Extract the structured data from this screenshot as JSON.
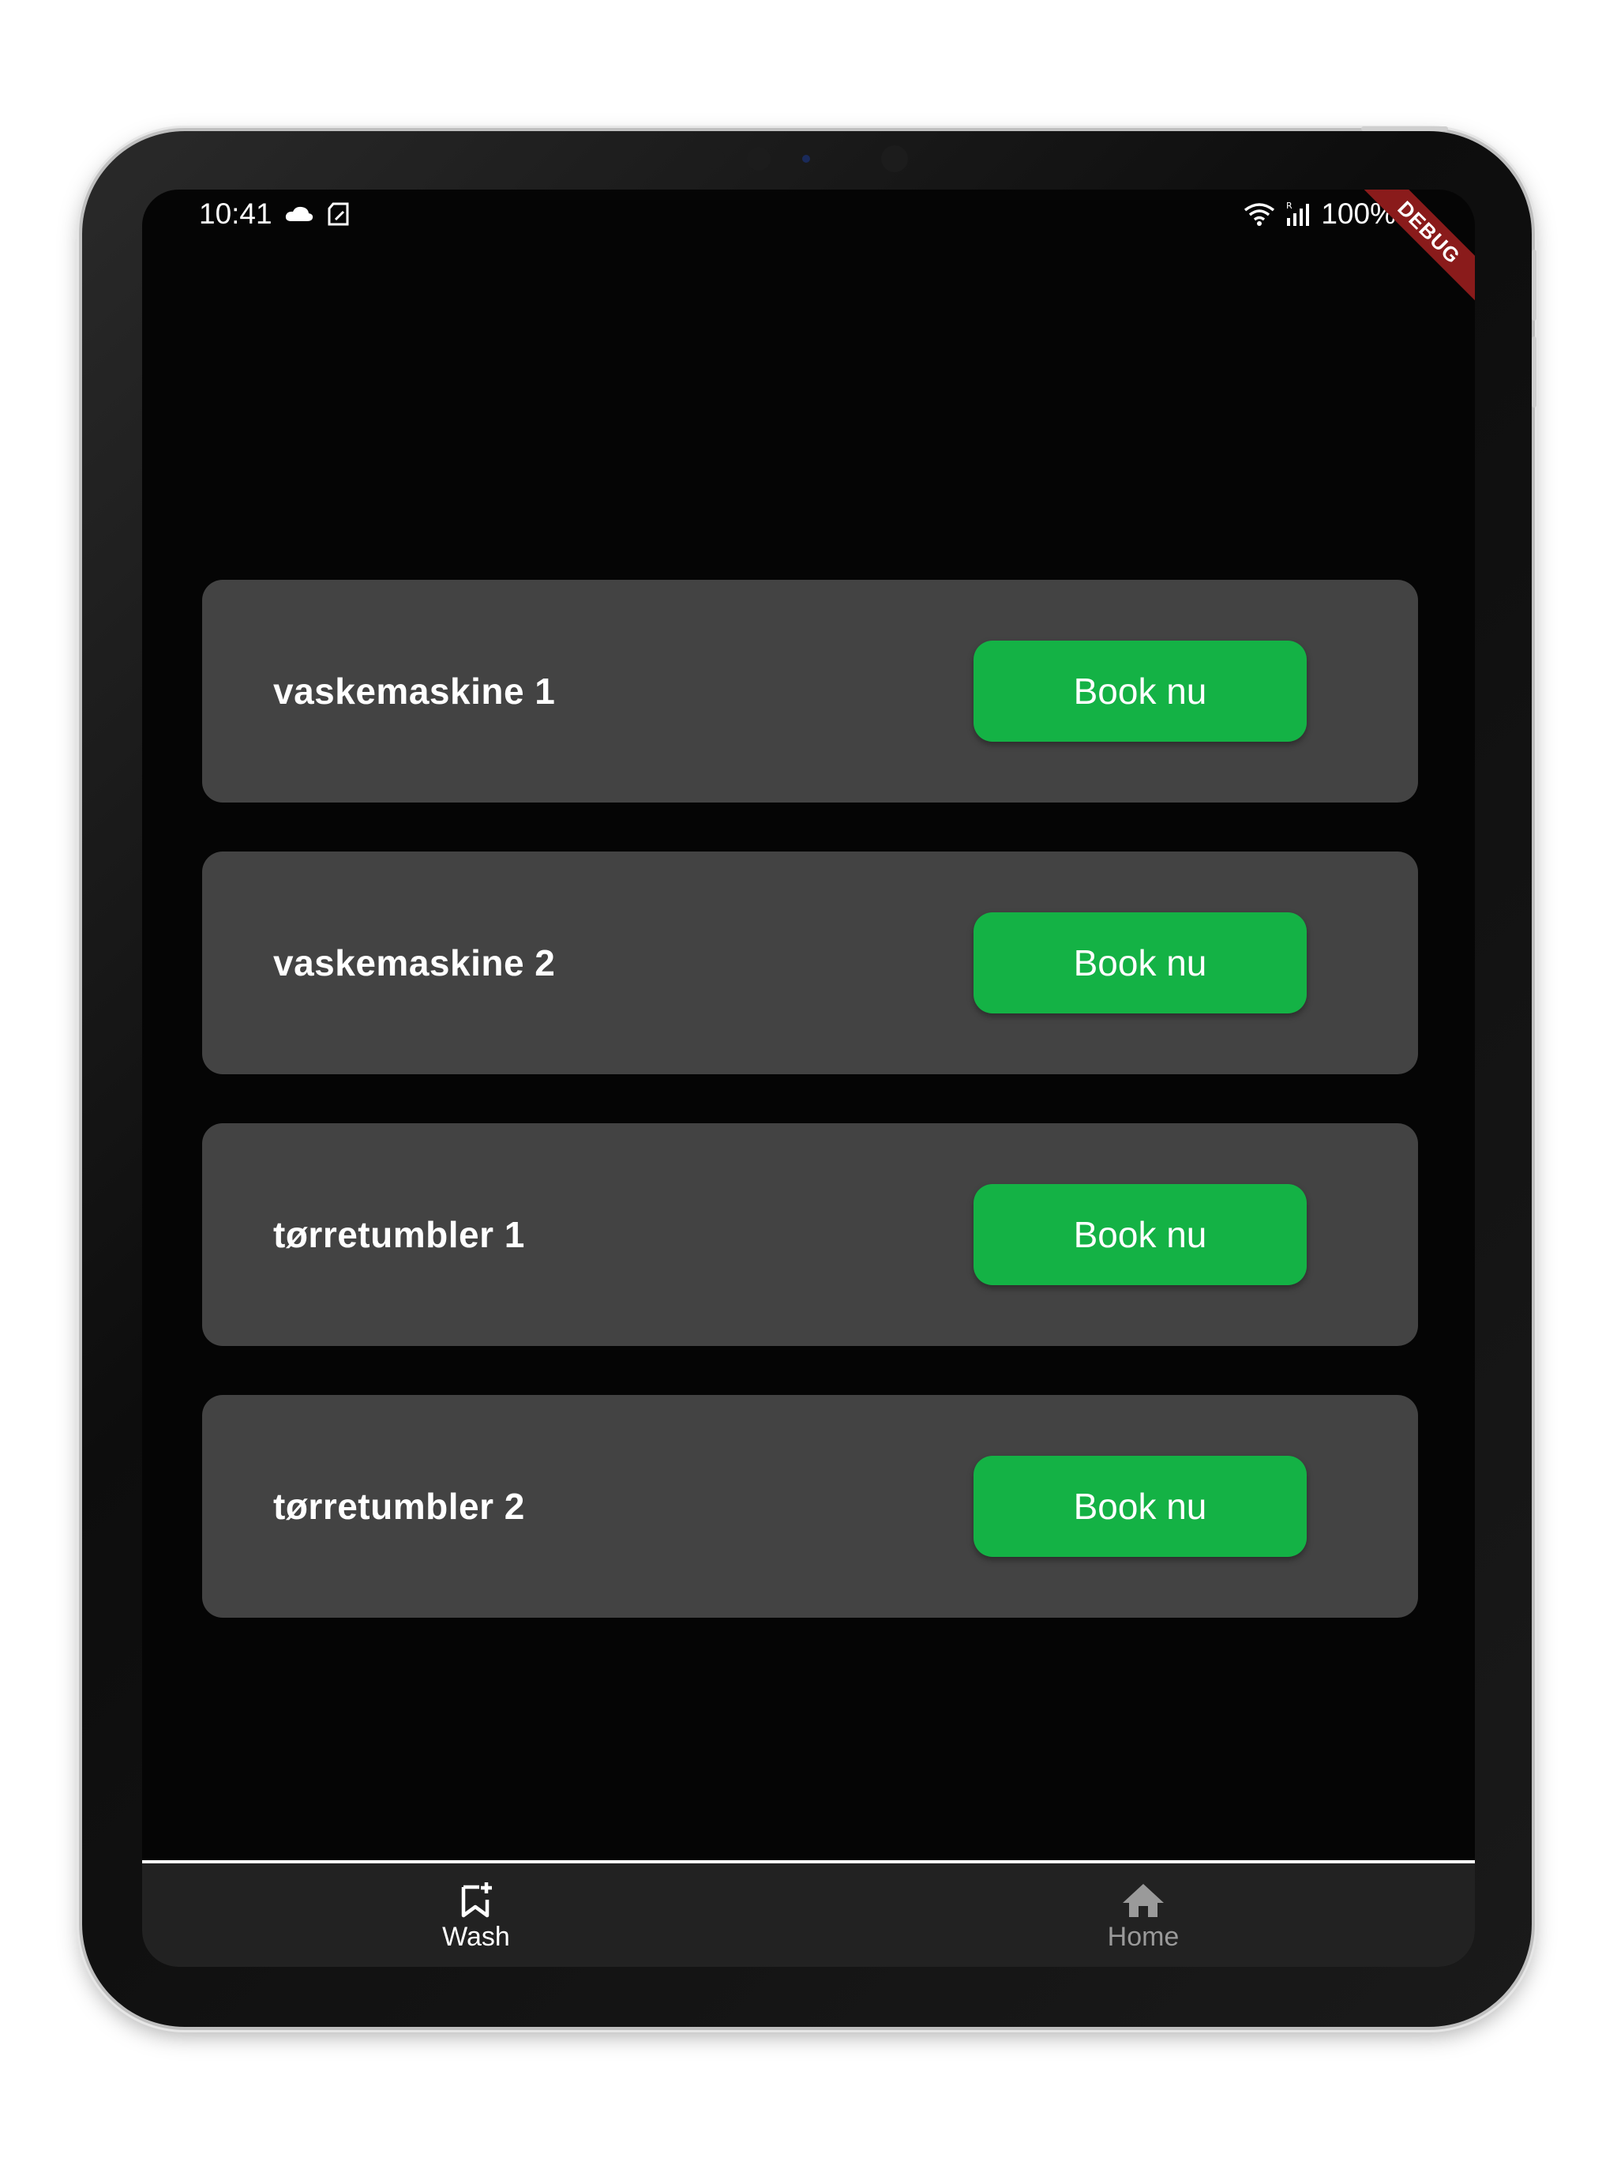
{
  "status_bar": {
    "time": "10:41",
    "battery_text": "100%"
  },
  "debug_banner": "DEBUG",
  "machines": [
    {
      "name": "vaskemaskine 1",
      "button_label": "Book nu"
    },
    {
      "name": "vaskemaskine 2",
      "button_label": "Book nu"
    },
    {
      "name": "tørretumbler 1",
      "button_label": "Book nu"
    },
    {
      "name": "tørretumbler 2",
      "button_label": "Book nu"
    }
  ],
  "bottom_nav": {
    "items": [
      {
        "label": "Wash",
        "icon": "bookmark-add-icon",
        "selected": true
      },
      {
        "label": "Home",
        "icon": "home-icon",
        "selected": false
      }
    ]
  },
  "colors": {
    "background": "#050505",
    "card": "#434343",
    "accent": "#14b245",
    "nav_background": "#222222",
    "nav_selected": "#ffffff",
    "nav_unselected": "#9a9a9a",
    "debug_ribbon": "#8a1b1b"
  }
}
